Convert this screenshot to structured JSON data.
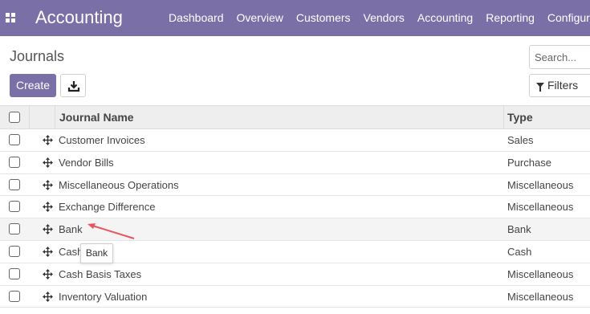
{
  "navbar": {
    "app_title": "Accounting",
    "menu": [
      "Dashboard",
      "Overview",
      "Customers",
      "Vendors",
      "Accounting",
      "Reporting",
      "Configura"
    ],
    "color": "#7b6fa8"
  },
  "control_panel": {
    "breadcrumb": "Journals",
    "create_label": "Create",
    "search_placeholder": "Search...",
    "filters_label": "Filters"
  },
  "table": {
    "headers": {
      "name": "Journal Name",
      "type": "Type"
    },
    "rows": [
      {
        "name": "Customer Invoices",
        "type": "Sales"
      },
      {
        "name": "Vendor Bills",
        "type": "Purchase"
      },
      {
        "name": "Miscellaneous Operations",
        "type": "Miscellaneous"
      },
      {
        "name": "Exchange Difference",
        "type": "Miscellaneous"
      },
      {
        "name": "Bank",
        "type": "Bank"
      },
      {
        "name": "Cash",
        "type": "Cash"
      },
      {
        "name": "Cash Basis Taxes",
        "type": "Miscellaneous"
      },
      {
        "name": "Inventory Valuation",
        "type": "Miscellaneous"
      }
    ]
  },
  "tooltip": {
    "text": "Bank"
  },
  "annotation_color": "#e8555a"
}
